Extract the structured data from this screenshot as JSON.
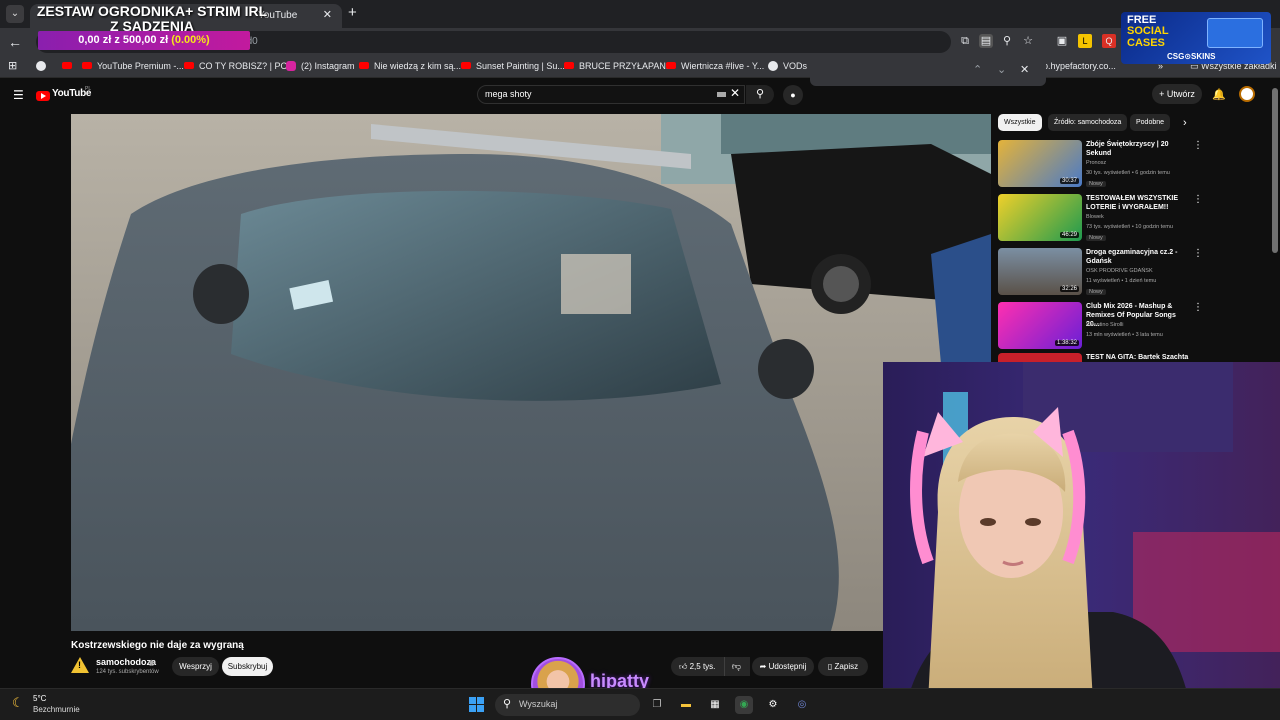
{
  "browser": {
    "tab_title": "YouTube",
    "tab_close": "✕",
    "new_tab": "+",
    "url_fragment": "lopErwd0",
    "bookmarks": [
      {
        "label": "YouTube Premium -..."
      },
      {
        "label": "CO TY ROBISZ? | PO..."
      },
      {
        "label": "(2) Instagram"
      },
      {
        "label": "Nie wiedzą z kim są..."
      },
      {
        "label": "Sunset Painting | Su..."
      },
      {
        "label": "BRUCE PRZYŁAPAN..."
      },
      {
        "label": "Wiertnicza #live - Y..."
      },
      {
        "label": "VODs"
      },
      {
        "label": "p.hypefactory.co..."
      },
      {
        "label": "Wszystkie zakładki"
      }
    ]
  },
  "overlay": {
    "goal_title": "ZESTAW OGRODNIKA+ STRIM IRL Z SADZENIA",
    "goal_progress": "0,00 zł z 500,00 zł",
    "goal_percent": "(0.00%)",
    "goal_fraction": 0.0,
    "ad_line1": "FREE",
    "ad_line2": "SOCIAL",
    "ad_line3": "CASES",
    "ad_brand": "CSG⊙SKINS",
    "streamer_name": "hipatty"
  },
  "youtube": {
    "logo": "YouTube",
    "country": "PL",
    "search_value": "mega shoty",
    "create_label": "Utwórz",
    "video": {
      "title": "Kostrzewskiego nie daje za wygraną",
      "channel": "samochodoza",
      "subscribers": "124 tys. subskrybentów",
      "support_label": "Wesprzyj",
      "subscribe_label": "Subskrybuj",
      "likes": "2,5 tys.",
      "share_label": "Udostępnij",
      "save_label": "Zapisz"
    },
    "chips": [
      "Wszystkie",
      "Źródło: samochodoza",
      "Podobne"
    ],
    "related": [
      {
        "title": "Zbóje Świętokrzyscy | 20 Sekund",
        "channel": "Pronosz",
        "meta": "30 tys. wyświetleń • 6 godzin temu",
        "duration": "30:37",
        "badge": "Nowy"
      },
      {
        "title": "TESTOWAŁEM WSZYSTKIE LOTERIE i WYGRAŁEM!!",
        "channel": "Blowek",
        "meta": "73 tys. wyświetleń • 10 godzin temu",
        "duration": "46:29",
        "badge": "Nowy"
      },
      {
        "title": "Droga egzaminacyjna cz.2 - Gdańsk",
        "channel": "OSK PRODRIVE GDAŃSK",
        "meta": "11 wyświetleń • 1 dzień temu",
        "duration": "32:26",
        "badge": "Nowy"
      },
      {
        "title": "Club Mix 2026 - Mashup & Remixes Of Popular Songs 20...",
        "channel": "Valentino Sirolli",
        "meta": "13 mln wyświetleń • 3 lata temu",
        "duration": "1:38:32",
        "badge": ""
      },
      {
        "title": "TEST NA GITA: Bartek Szachta",
        "channel": "",
        "meta": "",
        "duration": "",
        "badge": ""
      }
    ]
  },
  "taskbar": {
    "temperature": "5°C",
    "weather": "Bezchmurnie",
    "search_placeholder": "Wyszukaj"
  },
  "colors": {
    "yt_bg": "#0f0f0f",
    "yt_red": "#ff0000",
    "goal_bar": "#c21a9e",
    "goal_percent": "#f5e71a",
    "streamer_name": "#c98bff"
  }
}
